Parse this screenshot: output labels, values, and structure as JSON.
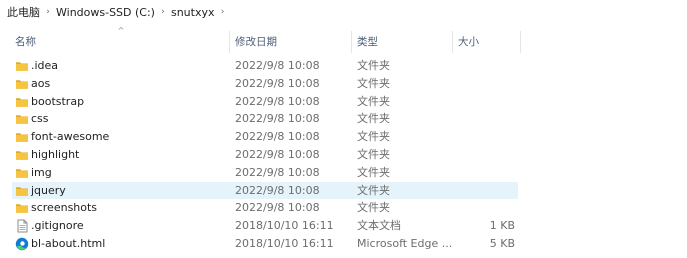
{
  "breadcrumb": {
    "items": [
      "此电脑",
      "Windows-SSD (C:)",
      "snutxyx"
    ],
    "separator": "›"
  },
  "columns": {
    "name": "名称",
    "modified": "修改日期",
    "type": "类型",
    "size": "大小",
    "sort_indicator": "^"
  },
  "files": [
    {
      "name": ".idea",
      "modified": "2022/9/8 10:08",
      "type": "文件夹",
      "size": "",
      "icon": "folder-icon"
    },
    {
      "name": "aos",
      "modified": "2022/9/8 10:08",
      "type": "文件夹",
      "size": "",
      "icon": "folder-icon"
    },
    {
      "name": "bootstrap",
      "modified": "2022/9/8 10:08",
      "type": "文件夹",
      "size": "",
      "icon": "folder-icon"
    },
    {
      "name": "css",
      "modified": "2022/9/8 10:08",
      "type": "文件夹",
      "size": "",
      "icon": "folder-icon"
    },
    {
      "name": "font-awesome",
      "modified": "2022/9/8 10:08",
      "type": "文件夹",
      "size": "",
      "icon": "folder-icon"
    },
    {
      "name": "highlight",
      "modified": "2022/9/8 10:08",
      "type": "文件夹",
      "size": "",
      "icon": "folder-icon"
    },
    {
      "name": "img",
      "modified": "2022/9/8 10:08",
      "type": "文件夹",
      "size": "",
      "icon": "folder-icon"
    },
    {
      "name": "jquery",
      "modified": "2022/9/8 10:08",
      "type": "文件夹",
      "size": "",
      "icon": "folder-icon",
      "selected": true
    },
    {
      "name": "screenshots",
      "modified": "2022/9/8 10:08",
      "type": "文件夹",
      "size": "",
      "icon": "folder-icon"
    },
    {
      "name": ".gitignore",
      "modified": "2018/10/10 16:11",
      "type": "文本文档",
      "size": "1 KB",
      "icon": "text-file-icon"
    },
    {
      "name": "bl-about.html",
      "modified": "2018/10/10 16:11",
      "type": "Microsoft Edge ...",
      "size": "5 KB",
      "icon": "edge-html-icon"
    }
  ],
  "colors": {
    "folder": "#f5c542",
    "folder_dark": "#e2a92a",
    "selected_row": "#e5f3fb",
    "header_text": "#4c607a",
    "edge_blue": "#0f7bd5",
    "edge_green": "#4fcf6a"
  }
}
